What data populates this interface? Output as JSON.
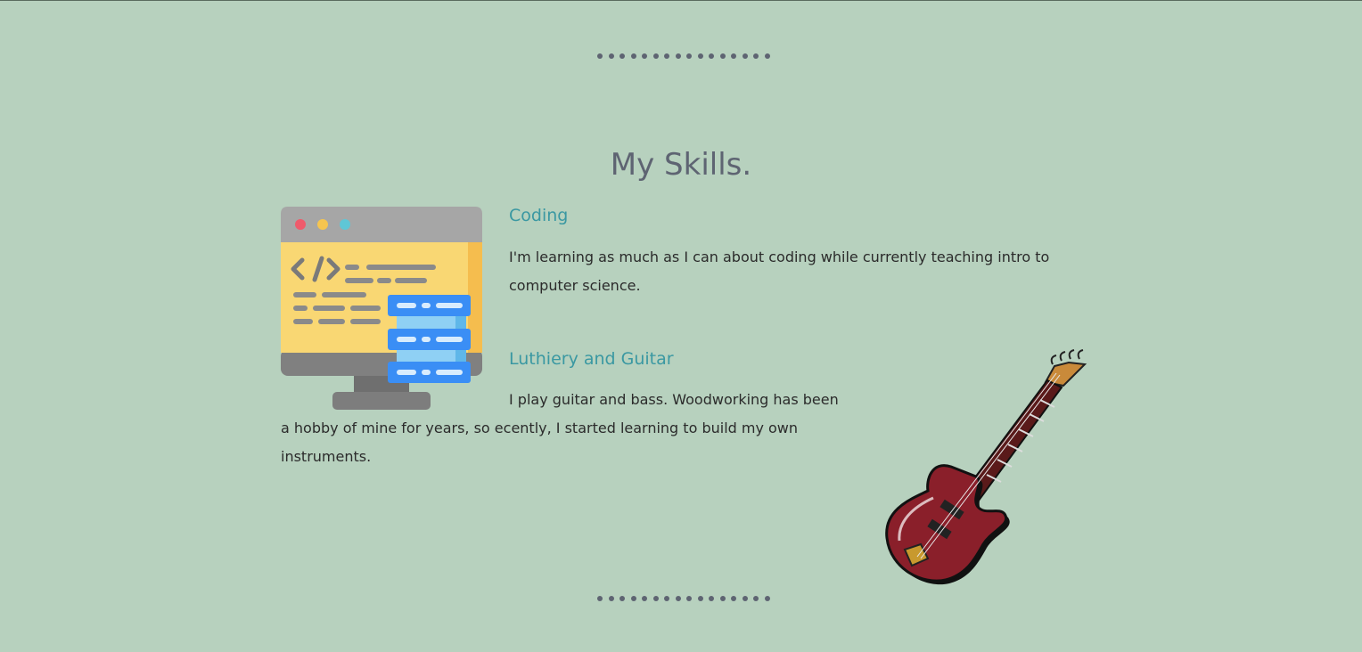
{
  "section": {
    "title": "My Skills."
  },
  "skills": [
    {
      "heading": "Coding",
      "description": "I'm learning as much as I can about coding while currently teaching intro to computer science.",
      "image_icon": "computer-code-icon"
    },
    {
      "heading": "Luthiery and Guitar",
      "description_line1": "I play guitar and bass. Woodworking has been",
      "description_line2": "a hobby of mine for years, so ecently, I started learning to build my own instruments.",
      "image_icon": "bass-guitar-icon"
    }
  ],
  "colors": {
    "background": "#b7d1be",
    "title": "#5e6472",
    "heading": "#3a98a2",
    "body_text": "#2b2b2b"
  }
}
